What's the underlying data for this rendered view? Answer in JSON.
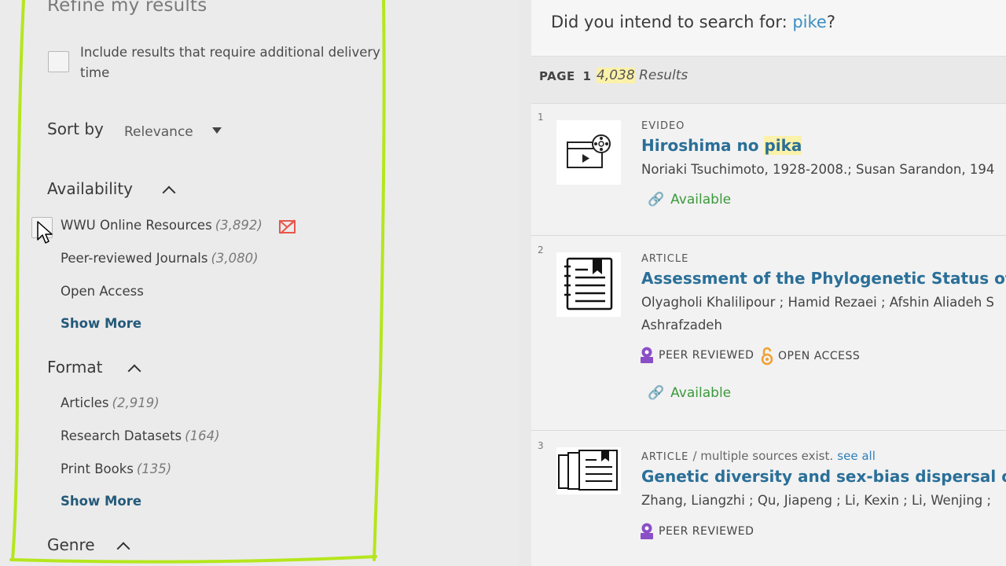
{
  "refine": {
    "title": "Refine my results",
    "delivery_label": "Include results that require additional delivery time",
    "sort_label": "Sort by",
    "sort_value": "Relevance",
    "availability": {
      "heading": "Availability",
      "items": [
        {
          "label": "WWU Online Resources",
          "count": "(3,892)"
        },
        {
          "label": "Peer-reviewed Journals",
          "count": "(3,080)"
        },
        {
          "label": "Open Access",
          "count": ""
        }
      ],
      "show_more": "Show More"
    },
    "format": {
      "heading": "Format",
      "items": [
        {
          "label": "Articles",
          "count": "(2,919)"
        },
        {
          "label": "Research Datasets",
          "count": "(164)"
        },
        {
          "label": "Print Books",
          "count": "(135)"
        }
      ],
      "show_more": "Show More"
    },
    "genre_heading": "Genre"
  },
  "didyou": {
    "prefix": "Did you intend to search for: ",
    "term": "pike",
    "suffix": "?"
  },
  "pagebar": {
    "page_label": "PAGE",
    "page_num": "1",
    "count": "4,038",
    "results_word": "Results"
  },
  "results": [
    {
      "num": "1",
      "type": "EVIDEO",
      "title_pre": "Hiroshima no ",
      "title_hl": "pika",
      "authors": "Noriaki Tsuchimoto, 1928-2008.; Susan Sarandon, 194",
      "availability": "Available"
    },
    {
      "num": "2",
      "type": "ARTICLE",
      "title": "Assessment of the Phylogenetic Status of Afg",
      "authors_line1": "Olyagholi Khalilipour ; Hamid Rezaei ; Afshin Aliadeh S",
      "authors_line2": "Ashrafzadeh",
      "badge_peer": "PEER REVIEWED",
      "badge_open": "OPEN ACCESS",
      "availability": "Available"
    },
    {
      "num": "3",
      "type": "ARTICLE",
      "type_extra": "/ multiple sources exist.",
      "see_all": "see all",
      "title": "Genetic diversity and sex-bias dispersal of pla",
      "authors": "Zhang, Liangzhi ; Qu, Jiapeng ; Li, Kexin ; Li, Wenjing ; ",
      "badge_peer": "PEER REVIEWED"
    }
  ],
  "colors": {
    "link": "#2a6f98",
    "available": "#3b9a3b",
    "highlight": "#fbf1a9",
    "annotation": "#b5e61d",
    "peer_badge": "#8a4fc7",
    "open_access": "#f0a030"
  }
}
